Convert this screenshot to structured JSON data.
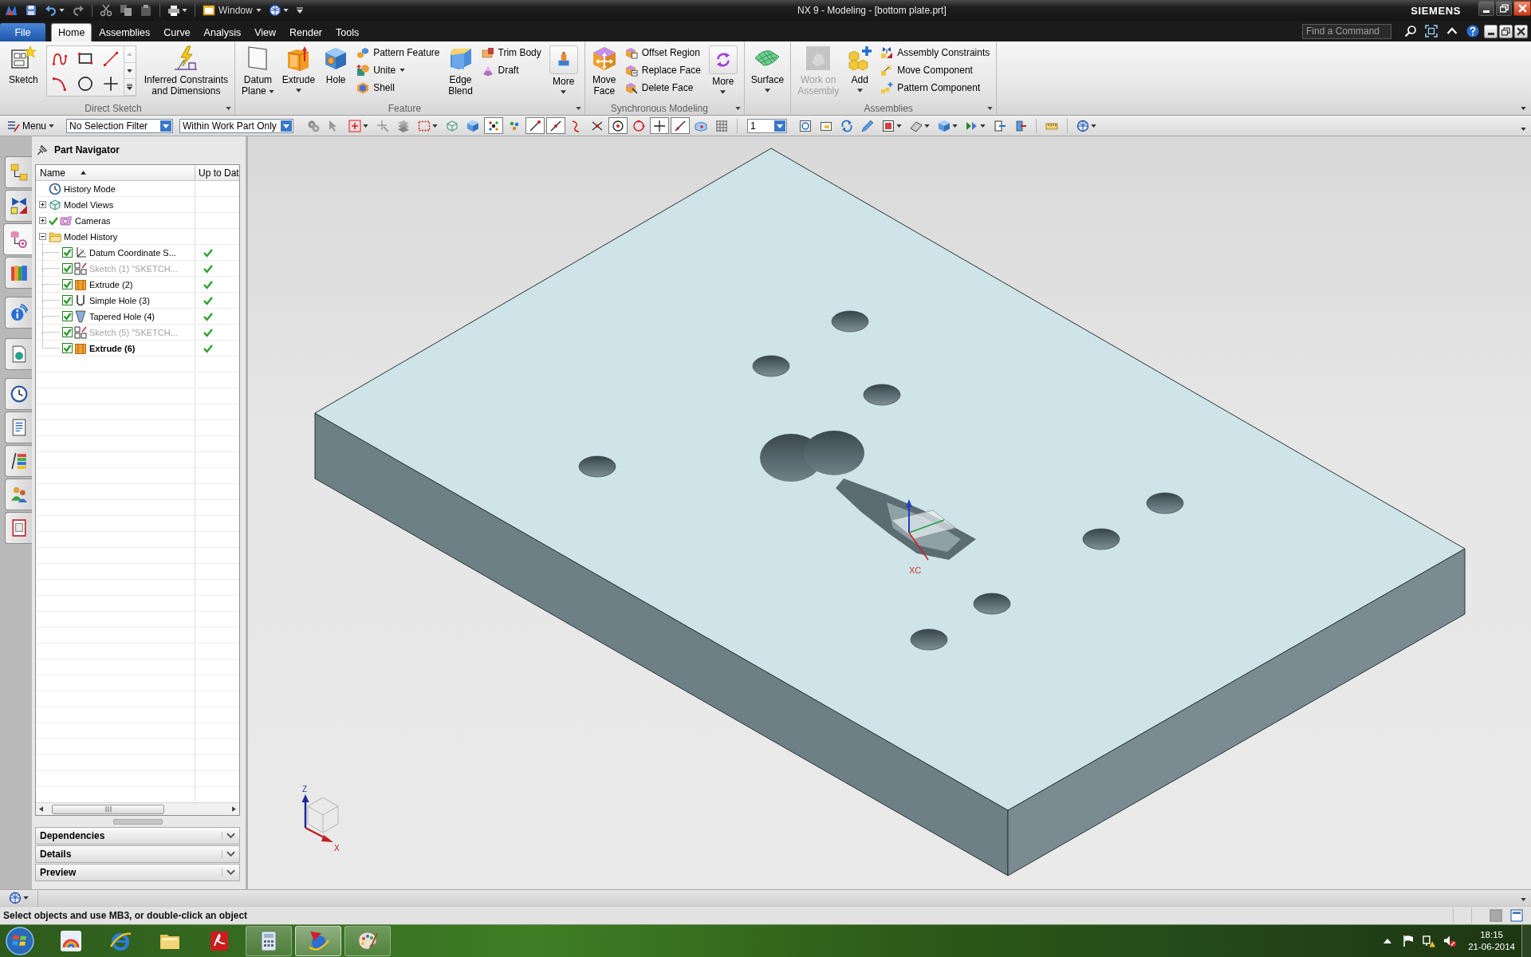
{
  "title_bar": {
    "window_menu": "Window",
    "title": "NX 9 - Modeling - [bottom plate.prt]",
    "brand": "SIEMENS"
  },
  "ribbon_tabs": [
    {
      "label": "File",
      "kind": "file",
      "selected": false
    },
    {
      "label": "Home",
      "kind": "tab",
      "selected": true
    },
    {
      "label": "Assemblies",
      "kind": "tab",
      "selected": false
    },
    {
      "label": "Curve",
      "kind": "tab",
      "selected": false
    },
    {
      "label": "Analysis",
      "kind": "tab",
      "selected": false
    },
    {
      "label": "View",
      "kind": "tab",
      "selected": false
    },
    {
      "label": "Render",
      "kind": "tab",
      "selected": false
    },
    {
      "label": "Tools",
      "kind": "tab",
      "selected": false
    }
  ],
  "command_finder": {
    "placeholder": "Find a Command"
  },
  "ribbon": [
    {
      "title": "Direct Sketch",
      "items": [
        {
          "kind": "large",
          "label": "Sketch",
          "dropdown": false,
          "disabled": false
        },
        {
          "kind": "gallery"
        },
        {
          "kind": "large",
          "label": "Inferred Constraints\nand Dimensions",
          "dropdown": false,
          "disabled": false
        }
      ]
    },
    {
      "title": "Feature",
      "items": [
        {
          "kind": "large",
          "label": "Datum\nPlane",
          "dropdown": true,
          "disabled": false
        },
        {
          "kind": "large",
          "label": "Extrude",
          "dropdown": true,
          "disabled": false
        },
        {
          "kind": "large",
          "label": "Hole",
          "dropdown": false,
          "disabled": false
        },
        {
          "kind": "column",
          "commands": [
            {
              "label": "Pattern Feature",
              "dropdown": false
            },
            {
              "label": "Unite",
              "dropdown": true
            },
            {
              "label": "Shell",
              "dropdown": false
            }
          ]
        },
        {
          "kind": "large",
          "label": "Edge\nBlend",
          "dropdown": false,
          "disabled": false
        },
        {
          "kind": "column",
          "commands": [
            {
              "label": "Trim Body",
              "dropdown": false
            },
            {
              "label": "Draft",
              "dropdown": false
            }
          ]
        },
        {
          "kind": "more",
          "label": "More",
          "dropdown": true,
          "disabled": false
        }
      ]
    },
    {
      "title": "Synchronous Modeling",
      "items": [
        {
          "kind": "large",
          "label": "Move\nFace",
          "dropdown": false,
          "disabled": false
        },
        {
          "kind": "column",
          "commands": [
            {
              "label": "Offset Region",
              "dropdown": false
            },
            {
              "label": "Replace Face",
              "dropdown": false
            },
            {
              "label": "Delete Face",
              "dropdown": false
            }
          ]
        },
        {
          "kind": "more",
          "label": "More",
          "dropdown": true,
          "disabled": false
        }
      ]
    },
    {
      "items": [
        {
          "kind": "large",
          "label": "Surface",
          "dropdown": true,
          "disabled": false
        }
      ]
    },
    {
      "title": "Assemblies",
      "items": [
        {
          "kind": "large",
          "label": "Work on\nAssembly",
          "dropdown": false,
          "disabled": true
        },
        {
          "kind": "large",
          "label": "Add",
          "dropdown": true,
          "disabled": false
        },
        {
          "kind": "column",
          "commands": [
            {
              "label": "Assembly Constraints",
              "dropdown": false
            },
            {
              "label": "Move Component",
              "dropdown": false
            },
            {
              "label": "Pattern Component",
              "dropdown": false
            }
          ]
        }
      ]
    }
  ],
  "selection_bar": {
    "menu": "Menu",
    "type_filter": "No Selection Filter",
    "scope": "Within Work Part Only",
    "snap_points": [
      {
        "on": true
      },
      {
        "on": false
      },
      {
        "on": true
      },
      {
        "on": true
      },
      {
        "on": false
      },
      {
        "on": false
      },
      {
        "on": true
      },
      {
        "on": false
      },
      {
        "on": true
      },
      {
        "on": true
      },
      {
        "on": false
      },
      {
        "on": false
      }
    ],
    "layer": "1"
  },
  "resource_bar": [
    {
      "selected": false
    },
    {
      "selected": false
    },
    {
      "selected": true
    },
    {
      "selected": false
    },
    {
      "selected": false
    },
    {
      "selected": false
    },
    {
      "selected": false
    },
    {
      "selected": false
    },
    {
      "selected": false
    },
    {
      "selected": false
    },
    {
      "selected": false
    }
  ],
  "navigator": {
    "title": "Part Navigator",
    "columns": [
      "Name",
      "Up to Dat"
    ],
    "tree": [
      {
        "kind": "history_mode",
        "label": "History Mode"
      },
      {
        "kind": "model_views",
        "label": "Model Views",
        "expanded": false
      },
      {
        "kind": "cameras",
        "label": "Cameras",
        "expanded": false,
        "checked": true
      },
      {
        "kind": "folder",
        "label": "Model History",
        "expanded": true,
        "children": [
          {
            "kind": "datum_csys",
            "label": "Datum Coordinate S...",
            "checked": true,
            "dimmed": false,
            "current": false,
            "up_to_date": true
          },
          {
            "kind": "sketch",
            "label": "Sketch (1) \"SKETCH...",
            "checked": true,
            "dimmed": true,
            "current": false,
            "up_to_date": true
          },
          {
            "kind": "extrude",
            "label": "Extrude (2)",
            "checked": true,
            "dimmed": false,
            "current": false,
            "up_to_date": true
          },
          {
            "kind": "simple_hole",
            "label": "Simple Hole (3)",
            "checked": true,
            "dimmed": false,
            "current": false,
            "up_to_date": true
          },
          {
            "kind": "tapered_hole",
            "label": "Tapered Hole (4)",
            "checked": true,
            "dimmed": false,
            "current": false,
            "up_to_date": true
          },
          {
            "kind": "sketch",
            "label": "Sketch (5) \"SKETCH...",
            "checked": true,
            "dimmed": true,
            "current": false,
            "up_to_date": true
          },
          {
            "kind": "extrude",
            "label": "Extrude (6)",
            "checked": true,
            "dimmed": false,
            "current": true,
            "up_to_date": true
          }
        ]
      }
    ],
    "panels": [
      {
        "title": "Dependencies",
        "expanded": false
      },
      {
        "title": "Details",
        "expanded": false
      },
      {
        "title": "Preview",
        "expanded": false
      }
    ]
  },
  "viewport": {
    "wcs_label": "XC",
    "triad_labels": [
      "Z",
      "X"
    ]
  },
  "status_bar": {
    "message": "Select objects and use MB3, or double-click an object"
  },
  "taskbar": {
    "apps": [
      {
        "running": false,
        "selected": false
      },
      {
        "running": false,
        "selected": false
      },
      {
        "running": false,
        "selected": false
      },
      {
        "running": false,
        "selected": false
      },
      {
        "running": true,
        "selected": false
      },
      {
        "running": true,
        "selected": true
      },
      {
        "running": true,
        "selected": false
      }
    ],
    "clock": {
      "time": "18:15",
      "date": "21-06-2014"
    }
  }
}
